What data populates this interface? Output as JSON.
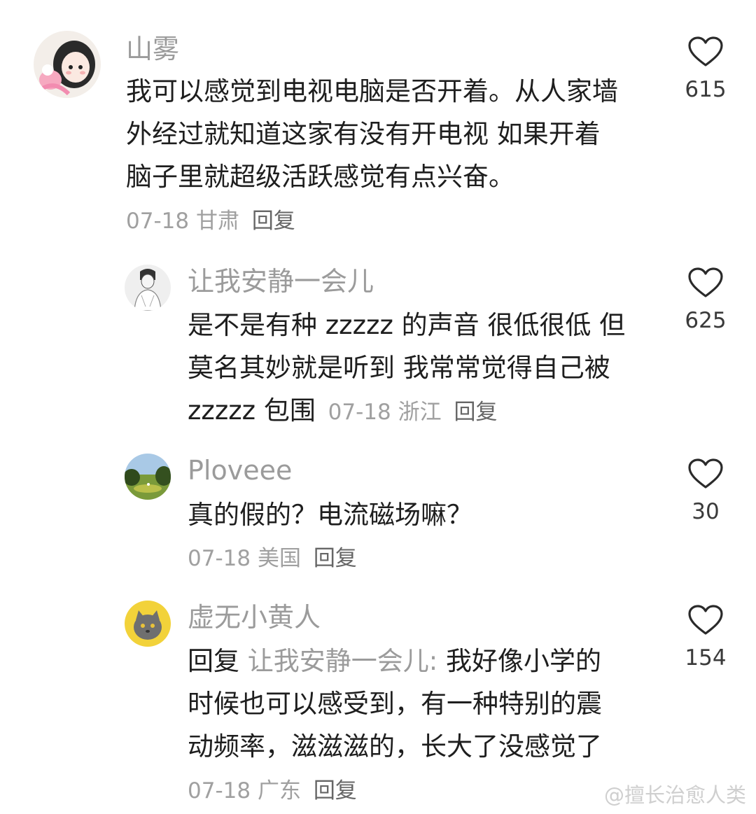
{
  "comments": [
    {
      "username": "山雾",
      "text_lines": [
        "我可以感觉到电视电脑是否开着。从人家墙",
        "外经过就知道这家有没有开电视 如果开着",
        "脑子里就超级活跃感觉有点兴奋。"
      ],
      "date": "07-18",
      "location": "甘肃",
      "reply_label": "回复",
      "likes": "615",
      "avatar_icon": "anime-girl-avatar-icon"
    },
    {
      "username": "让我安静一会儿",
      "text_lines": [
        "是不是有种 zzzzz 的声音 很低很低 但",
        "莫名其妙就是听到 我常常觉得自己被",
        "zzzzz 包围"
      ],
      "date": "07-18",
      "location": "浙江",
      "reply_label": "回复",
      "likes": "625",
      "avatar_icon": "sketch-person-avatar-icon"
    },
    {
      "username": "Ploveee",
      "text_lines": [
        "真的假的？电流磁场嘛？"
      ],
      "date": "07-18",
      "location": "美国",
      "reply_label": "回复",
      "likes": "30",
      "avatar_icon": "landscape-avatar-icon"
    },
    {
      "username": "虚无小黄人",
      "reply_prefix": "回复 ",
      "reply_target": "让我安静一会儿:",
      "text_first_line_rest": " 我好像小学的",
      "text_lines": [
        "时候也可以感受到，有一种特别的震",
        "动频率，滋滋滋的，长大了没感觉了"
      ],
      "date": "07-18",
      "location": "广东",
      "reply_label": "回复",
      "likes": "154",
      "avatar_icon": "cat-avatar-icon"
    }
  ],
  "watermark": "@擅长治愈人类",
  "colors": {
    "username": "#9b9b9b",
    "meta": "#a0a0a0",
    "text": "#1e1e1e",
    "heart_stroke": "#2a2a2a"
  }
}
